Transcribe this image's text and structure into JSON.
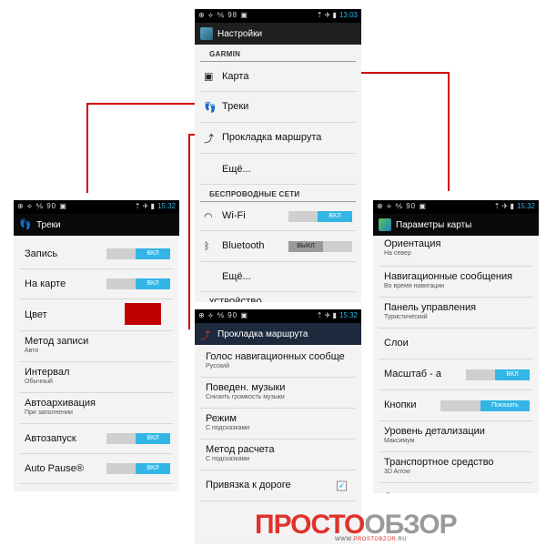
{
  "statusbar": {
    "icons_left_1": "⊕ ⟡ ⅍ 98 ▣",
    "icons_left_2": "⊕ ⟡ ⅍ 90 ▣",
    "icons_right": "⇡ ✈ ▮",
    "time_main": "13:03",
    "time_other": "15:32"
  },
  "main_settings": {
    "title": "Настройки",
    "section_garmin": "GARMIN",
    "items": [
      {
        "label": "Карта"
      },
      {
        "label": "Треки"
      },
      {
        "label": "Прокладка маршрута"
      },
      {
        "label": "Ещё..."
      }
    ],
    "section_wireless": "БЕСПРОВОДНЫЕ СЕТИ",
    "wifi": {
      "label": "Wi-Fi",
      "toggle": "ВКЛ"
    },
    "bluetooth": {
      "label": "Bluetooth",
      "toggle": "ВЫКЛ"
    },
    "more2": "Ещё...",
    "section_device": "УСТРОЙСТВО"
  },
  "tracks": {
    "title": "Треки",
    "rows": [
      {
        "label": "Запись",
        "toggle": "ВКЛ"
      },
      {
        "label": "На карте",
        "toggle": "ВКЛ"
      },
      {
        "label": "Цвет"
      },
      {
        "label": "Метод записи",
        "sub": "Авто"
      },
      {
        "label": "Интервал",
        "sub": "Обычный"
      },
      {
        "label": "Автоархивация",
        "sub": "При заполнении"
      },
      {
        "label": "Автозапуск",
        "toggle": "ВКЛ"
      },
      {
        "label": "Auto Pause®",
        "toggle": "ВКЛ"
      }
    ],
    "color_value": "#c00000"
  },
  "routing": {
    "title": "Прокладка маршрута",
    "rows": [
      {
        "label": "Голос навигационных сообще",
        "sub": "Русский"
      },
      {
        "label": "Поведен. музыки",
        "sub": "Снизить громкость музыки"
      },
      {
        "label": "Режим",
        "sub": "С подсказками"
      },
      {
        "label": "Метод расчета",
        "sub": "С подсказками"
      },
      {
        "label": "Привязка к дороге",
        "checked": "✔"
      }
    ]
  },
  "map_params": {
    "title": "Параметры карты",
    "rows": [
      {
        "label": "Ориентация",
        "sub": "На север"
      },
      {
        "label": "Навигационные сообщения",
        "sub": "Во время навигации"
      },
      {
        "label": "Панель управления",
        "sub": "Туристический"
      },
      {
        "label": "Слои"
      },
      {
        "label": "Масштаб - а",
        "toggle": "ВКЛ"
      },
      {
        "label": "Кнопки",
        "toggle": "Показать"
      },
      {
        "label": "Уровень детализации",
        "sub": "Максимум"
      },
      {
        "label": "Транспортное средство",
        "sub": "3D Arrow"
      },
      {
        "label": "Сведения о карте"
      }
    ]
  },
  "logo": {
    "part1": "ПРОСТО",
    "part2": "ОБЗОР",
    "url_prefix": "WWW.",
    "url_brand": "PROSTOBZOR",
    "url_suffix": ".RU"
  },
  "colors": {
    "accent": "#33b5e5",
    "connector": "#d00000",
    "brand_red": "#e0322b"
  }
}
